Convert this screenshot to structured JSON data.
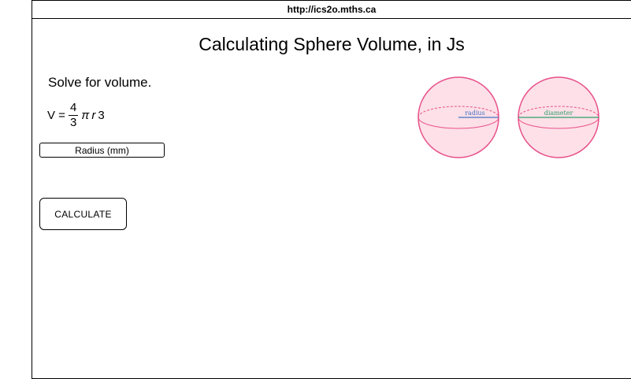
{
  "browser": {
    "url": "http://ics2o.mths.ca"
  },
  "page": {
    "title": "Calculating Sphere Volume, in Js",
    "instructions": "Solve for volume."
  },
  "formula": {
    "lhs": "V =",
    "numerator": "4",
    "denominator": "3",
    "pi": "π",
    "variable": "r",
    "exponent": "3"
  },
  "radius_input": {
    "placeholder": "Radius (mm)",
    "value": ""
  },
  "calculate_button": {
    "label": "CALCULATE"
  },
  "diagram": {
    "radius_label": "radius",
    "diameter_label": "diameter",
    "colors": {
      "sphere_fill": "#fde0e8",
      "sphere_stroke": "#e8508a",
      "radius_line": "#4472c4",
      "diameter_line": "#2e9e6a"
    }
  }
}
